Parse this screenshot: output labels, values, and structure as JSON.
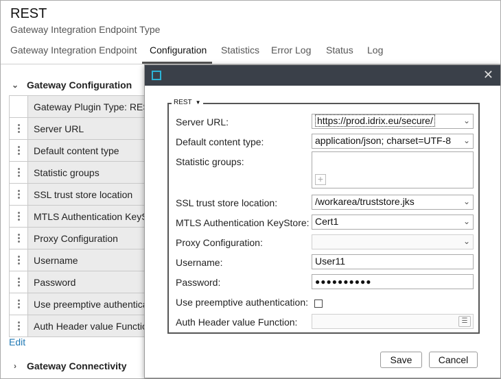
{
  "header": {
    "title": "REST",
    "subtitle": "Gateway Integration Endpoint Type"
  },
  "tabs": [
    {
      "label": "Gateway Integration Endpoint"
    },
    {
      "label": "Configuration"
    },
    {
      "label": "Statistics"
    },
    {
      "label": "Error Log"
    },
    {
      "label": "Status"
    },
    {
      "label": "Log"
    }
  ],
  "sections": {
    "gateway_configuration": "Gateway Configuration",
    "gateway_connectivity": "Gateway Connectivity"
  },
  "property_rows": [
    "Gateway Plugin Type: REST",
    "Server URL",
    "Default content type",
    "Statistic groups",
    "SSL trust store location",
    "MTLS Authentication KeyStore",
    "Proxy Configuration",
    "Username",
    "Password",
    "Use preemptive authentication",
    "Auth Header value Function"
  ],
  "edit_link": "Edit",
  "dialog": {
    "group_label": "REST",
    "fields": {
      "server_url": {
        "label": "Server URL:",
        "value": "https://prod.idrix.eu/secure/"
      },
      "content_type": {
        "label": "Default content type:",
        "value": "application/json; charset=UTF-8"
      },
      "statistic_groups": {
        "label": "Statistic groups:"
      },
      "ssl_trust_store": {
        "label": "SSL trust store location:",
        "value": "/workarea/truststore.jks"
      },
      "mtls_keystore": {
        "label": "MTLS Authentication KeyStore:",
        "value": "Cert1"
      },
      "proxy": {
        "label": "Proxy Configuration:",
        "value": ""
      },
      "username": {
        "label": "Username:",
        "value": "User11"
      },
      "password": {
        "label": "Password:",
        "value": "●●●●●●●●●●"
      },
      "preemptive": {
        "label": "Use preemptive authentication:",
        "checked": false
      },
      "auth_header_fn": {
        "label": "Auth Header value Function:",
        "value": ""
      }
    },
    "save_label": "Save",
    "cancel_label": "Cancel"
  },
  "colors": {
    "dialog_titlebar": "#3a4049",
    "dialog_icon": "#2db3d6",
    "link": "#1f78b4",
    "row_bg": "#ebebeb"
  }
}
